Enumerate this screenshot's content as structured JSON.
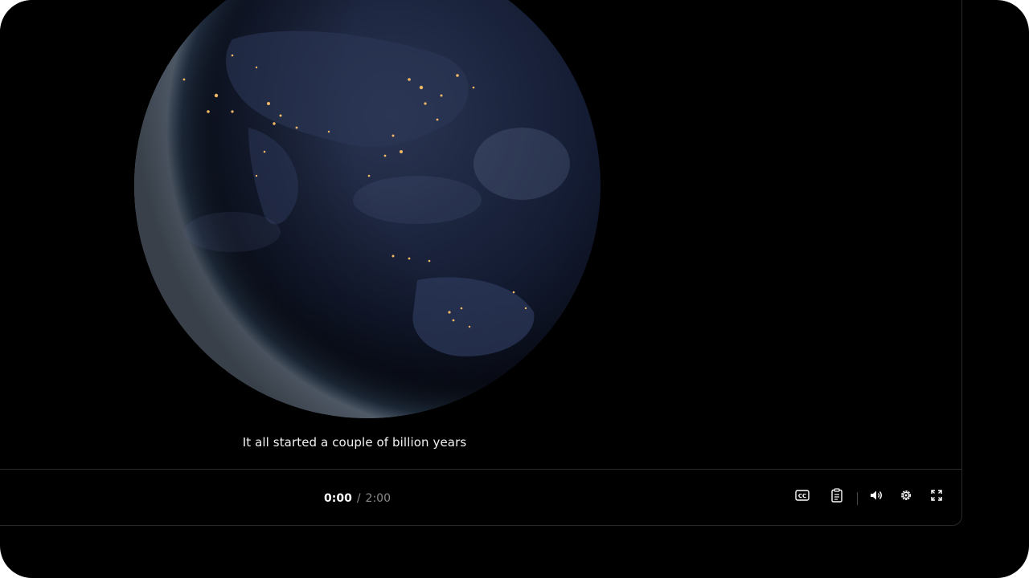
{
  "video": {
    "caption": "It all started a couple of billion years"
  },
  "controls": {
    "current_time": "0:00",
    "separator": "/",
    "duration": "2:00",
    "icons": [
      "closed-captions-icon",
      "transcript-icon",
      "volume-icon",
      "settings-icon",
      "fullscreen-icon"
    ]
  },
  "colors": {
    "background": "#000000",
    "text": "#ffffff",
    "muted": "#8a8a8a"
  }
}
